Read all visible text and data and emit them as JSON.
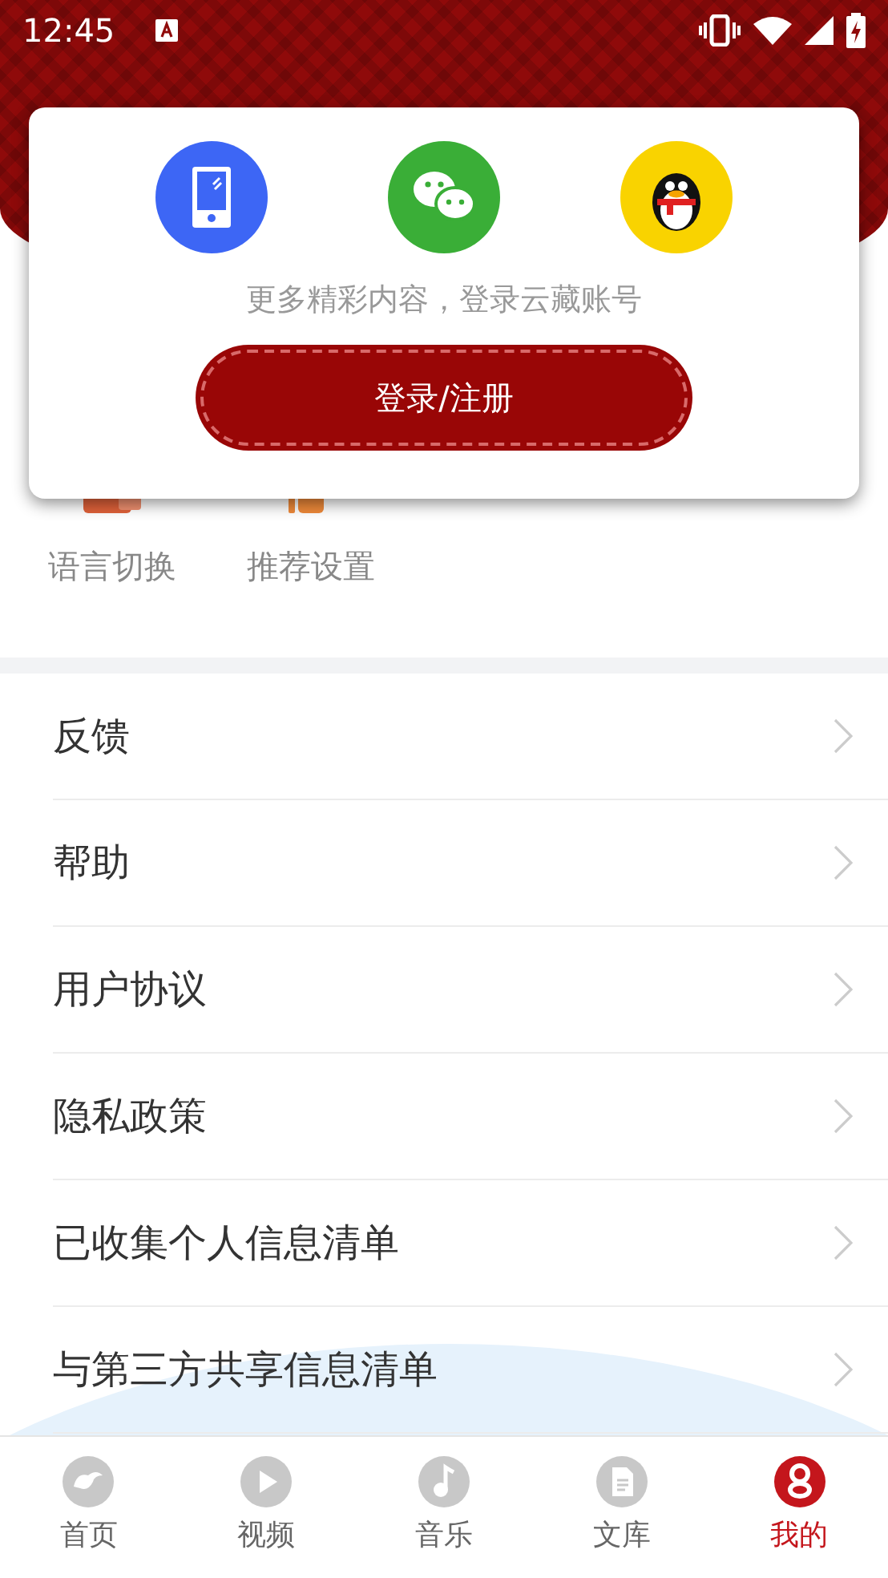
{
  "status_bar": {
    "time": "12:45"
  },
  "login_popup": {
    "options": [
      {
        "kind": "phone"
      },
      {
        "kind": "wechat"
      },
      {
        "kind": "qq"
      }
    ],
    "prompt": "更多精彩内容，登录云藏账号",
    "button": "登录/注册"
  },
  "shortcuts": [
    {
      "label": "语言切换",
      "kind": "language"
    },
    {
      "label": "推荐设置",
      "kind": "recommend"
    }
  ],
  "menu": [
    {
      "label": "反馈"
    },
    {
      "label": "帮助"
    },
    {
      "label": "用户协议"
    },
    {
      "label": "隐私政策"
    },
    {
      "label": "已收集个人信息清单"
    },
    {
      "label": "与第三方共享信息清单"
    }
  ],
  "tab_bar": [
    {
      "label": "首页",
      "kind": "home",
      "selected": false
    },
    {
      "label": "视频",
      "kind": "video",
      "selected": false
    },
    {
      "label": "音乐",
      "kind": "music",
      "selected": false
    },
    {
      "label": "文库",
      "kind": "docs",
      "selected": false
    },
    {
      "label": "我的",
      "kind": "me",
      "selected": true
    }
  ]
}
